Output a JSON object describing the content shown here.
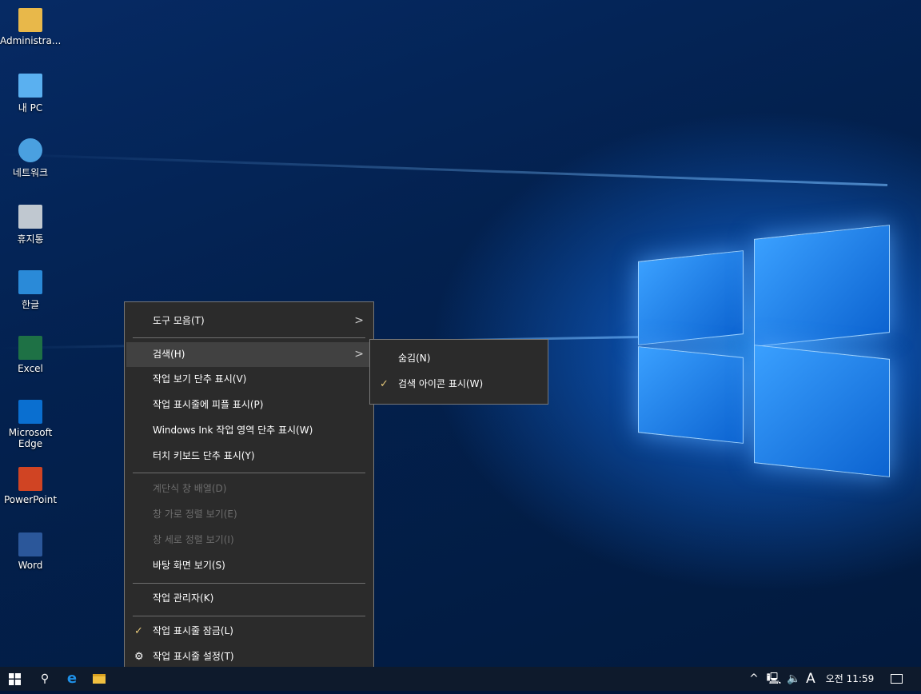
{
  "desktop_icons": [
    {
      "label": "Administra...",
      "icon": "user-folder-icon",
      "color": "#e8b84a"
    },
    {
      "label": "내 PC",
      "icon": "computer-icon",
      "color": "#5ab0f0"
    },
    {
      "label": "네트워크",
      "icon": "network-icon",
      "color": "#4aa0e0"
    },
    {
      "label": "휴지통",
      "icon": "recycle-bin-icon",
      "color": "#c0c8d0"
    },
    {
      "label": "한글",
      "icon": "hangul-app-icon",
      "color": "#2a8ad8"
    },
    {
      "label": "Excel",
      "icon": "excel-icon",
      "color": "#1e7145"
    },
    {
      "label": "Microsoft Edge",
      "icon": "edge-icon",
      "color": "#0a6fd0"
    },
    {
      "label": "PowerPoint",
      "icon": "powerpoint-icon",
      "color": "#d04423"
    },
    {
      "label": "Word",
      "icon": "word-icon",
      "color": "#2b579a"
    }
  ],
  "context_menu": {
    "toolbars": "도구 모음(T)",
    "search": "검색(H)",
    "task_view": "작업 보기 단추 표시(V)",
    "people": "작업 표시줄에 피플 표시(P)",
    "ink": "Windows Ink 작업 영역 단추 표시(W)",
    "touch_keyboard": "터치 키보드 단추 표시(Y)",
    "cascade": "계단식 창 배열(D)",
    "stacked": "창 가로 정렬 보기(E)",
    "side_by_side": "창 세로 정렬 보기(I)",
    "show_desktop": "바탕 화면 보기(S)",
    "task_manager": "작업 관리자(K)",
    "lock_taskbar": "작업 표시줄 잠금(L)",
    "taskbar_settings": "작업 표시줄 설정(T)"
  },
  "search_submenu": {
    "hidden": "숨김(N)",
    "show_icon": "검색 아이콘 표시(W)"
  },
  "taskbar": {
    "ime": "A",
    "time": "오전 11:59"
  },
  "colors": {
    "menu_bg": "#2b2b2b",
    "check": "#e6c87a",
    "taskbar": "#0e1a2c"
  }
}
